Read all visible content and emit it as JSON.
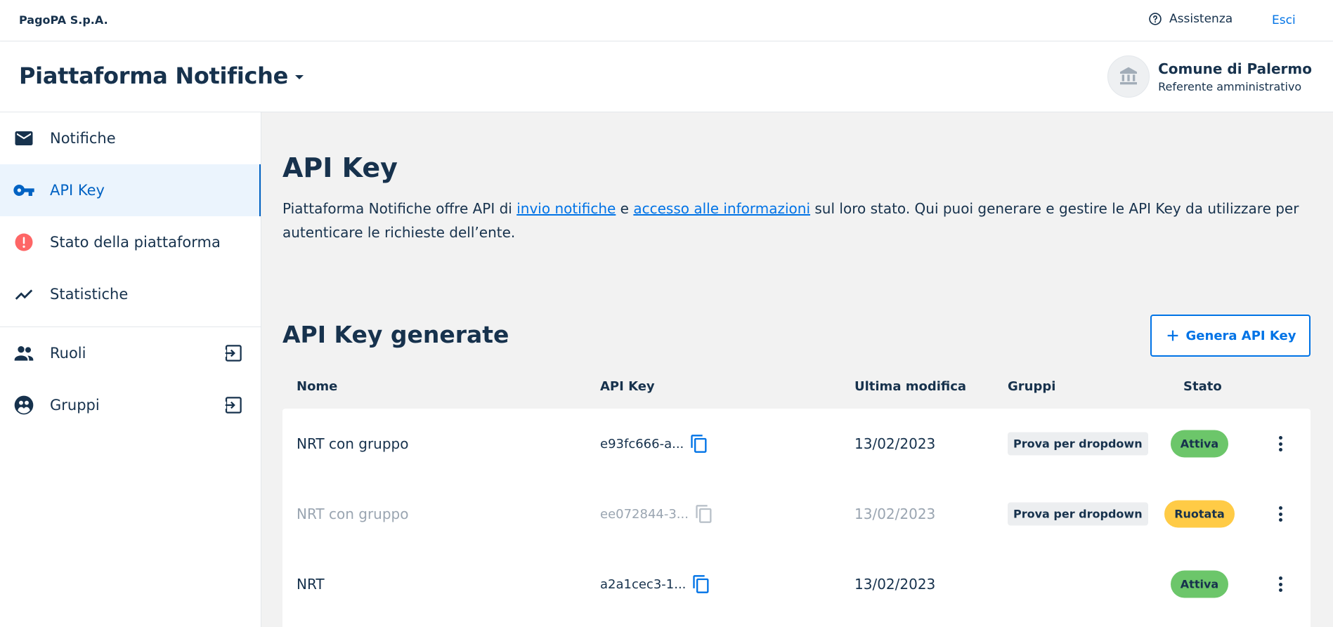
{
  "topbar": {
    "brand": "PagoPA S.p.A.",
    "assistance_label": "Assistenza",
    "logout_label": "Esci"
  },
  "header": {
    "product_name": "Piattaforma Notifiche",
    "party_name": "Comune di Palermo",
    "party_role": "Referente amministrativo"
  },
  "sidebar": {
    "items": [
      {
        "label": "Notifiche",
        "icon": "mail-icon"
      },
      {
        "label": "API Key",
        "icon": "key-icon",
        "active": true
      },
      {
        "label": "Stato della piattaforma",
        "icon": "error-icon"
      },
      {
        "label": "Statistiche",
        "icon": "trending-icon"
      }
    ],
    "external_items": [
      {
        "label": "Ruoli",
        "icon": "people-icon"
      },
      {
        "label": "Gruppi",
        "icon": "group-icon"
      }
    ]
  },
  "main": {
    "title": "API Key",
    "description": {
      "part1": "Piattaforma Notifiche offre API di ",
      "link1": "invio notifiche",
      "part2": " e ",
      "link2": "accesso alle informazioni",
      "part3": " sul loro stato. Qui puoi generare e gestire le API Key da utilizzare per autenticare le richieste dell’ente."
    },
    "section_title": "API Key generate",
    "generate_button": "Genera API Key",
    "table": {
      "headers": {
        "name": "Nome",
        "key": "API Key",
        "date": "Ultima modifica",
        "groups": "Gruppi",
        "status": "Stato"
      },
      "rows": [
        {
          "name": "NRT con gruppo",
          "key": "e93fc666-a...",
          "date": "13/02/2023",
          "group": "Prova per dropdown",
          "status": "Attiva"
        },
        {
          "name": "NRT con gruppo",
          "key": "ee072844-3...",
          "date": "13/02/2023",
          "group": "Prova per dropdown",
          "status": "Ruotata"
        },
        {
          "name": "NRT",
          "key": "a2a1cec3-1...",
          "date": "13/02/2023",
          "group": "",
          "status": "Attiva"
        }
      ]
    }
  },
  "colors": {
    "primary": "#0073e6",
    "text": "#17324d",
    "status_active": "#6cc66a",
    "status_rotated": "#ffcb46",
    "error": "#fe6666"
  }
}
